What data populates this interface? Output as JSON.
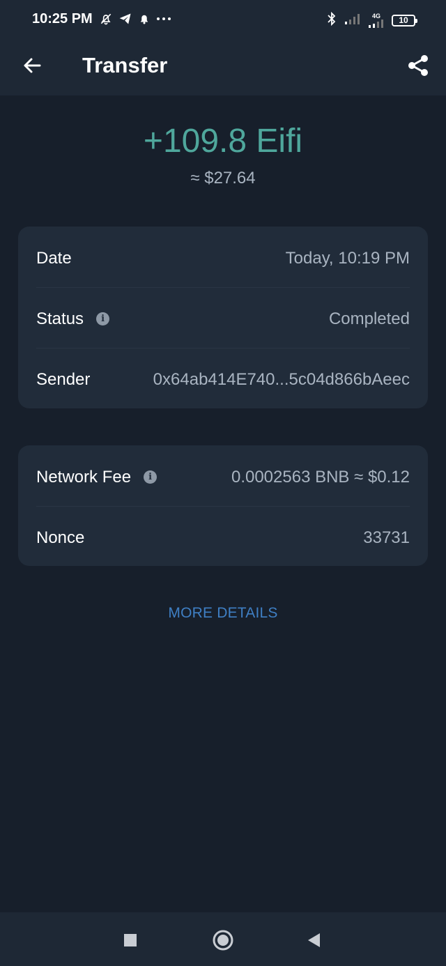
{
  "status_bar": {
    "time": "10:25 PM",
    "network": "4G",
    "battery": "10"
  },
  "app_bar": {
    "title": "Transfer"
  },
  "transaction": {
    "amount": "+109.8 Eifi",
    "fiat_value": "≈ $27.64"
  },
  "details": [
    {
      "label": "Date",
      "value": "Today, 10:19 PM",
      "info": false
    },
    {
      "label": "Status",
      "value": "Completed",
      "info": true
    },
    {
      "label": "Sender",
      "value": "0x64ab414E740...5c04d866bAeec",
      "info": false
    }
  ],
  "fees": [
    {
      "label": "Network Fee",
      "value": "0.0002563 BNB ≈ $0.12",
      "info": true
    },
    {
      "label": "Nonce",
      "value": "33731",
      "info": false
    }
  ],
  "more_details_label": "MORE DETAILS",
  "colors": {
    "background": "#171f2b",
    "header": "#1e2835",
    "card": "#212c3a",
    "amount_green": "#4fa79c",
    "link_blue": "#3f7fc4",
    "secondary_text": "#a9b4c1"
  },
  "icons": {
    "back": "arrow-left-icon",
    "share": "share-icon",
    "info": "info-icon"
  }
}
